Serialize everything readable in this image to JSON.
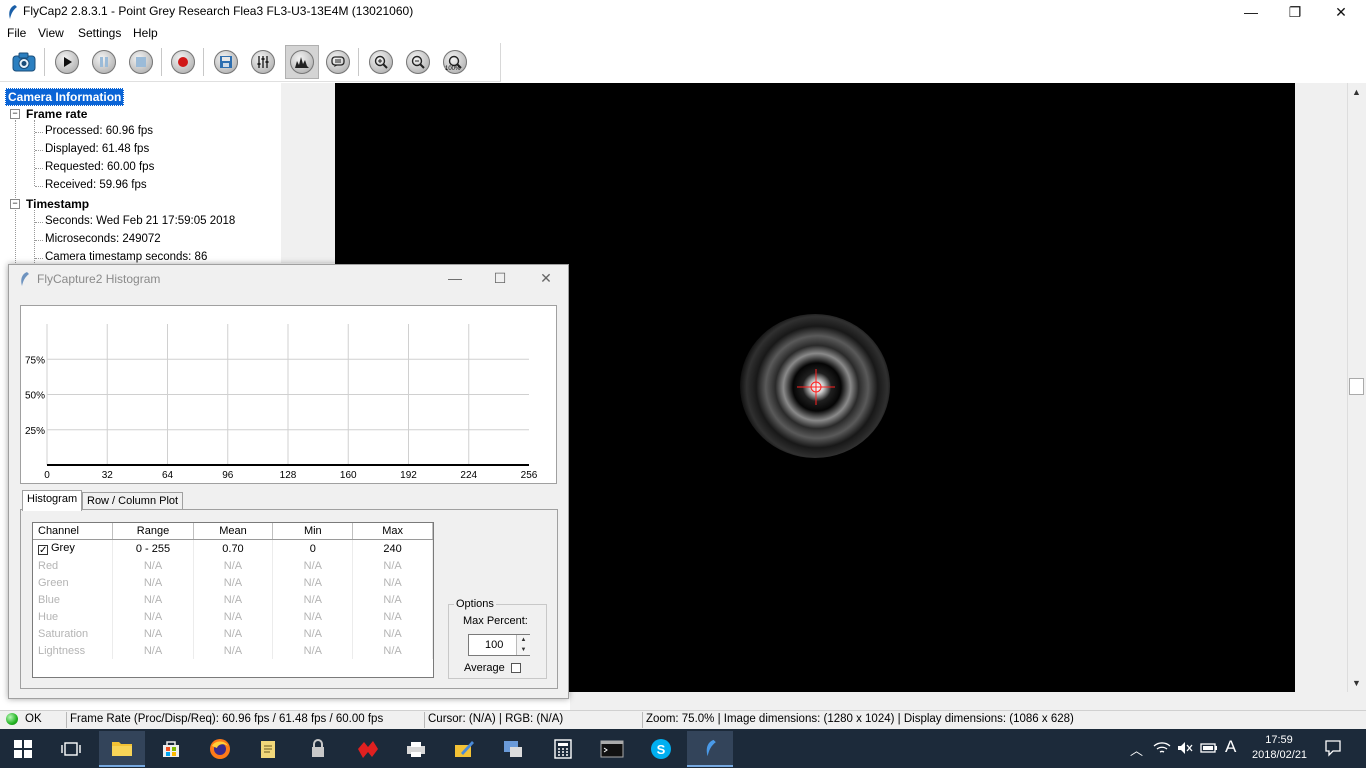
{
  "window": {
    "title": "FlyCap2 2.8.3.1 - Point Grey Research Flea3 FL3-U3-13E4M (13021060)",
    "minimize_glyph": "—",
    "maximize_glyph": "❐",
    "close_glyph": "✕"
  },
  "menu": [
    "File",
    "View",
    "Settings",
    "Help"
  ],
  "toolbar": {
    "buttons": [
      "camera-icon",
      "play-icon",
      "pause-icon",
      "stop-icon",
      "record-icon",
      "save-icon",
      "settings-sliders-icon",
      "histogram-icon",
      "event-stats-icon",
      "zoom-in-icon",
      "zoom-out-icon",
      "zoom-100-icon"
    ],
    "zoom_100_label": "100%"
  },
  "tree": {
    "root": "Camera Information",
    "frame_rate": {
      "label": "Frame rate",
      "items": [
        "Processed: 60.96 fps",
        "Displayed: 61.48 fps",
        "Requested: 60.00 fps",
        "Received: 59.96 fps"
      ]
    },
    "timestamp": {
      "label": "Timestamp",
      "items": [
        "Seconds: Wed Feb 21 17:59:05 2018",
        "Microseconds: 249072",
        "Camera timestamp seconds: 86"
      ]
    },
    "expanded_glyph": "−"
  },
  "histogram_window": {
    "title": "FlyCapture2 Histogram",
    "minimize_glyph": "—",
    "maximize_glyph": "☐",
    "close_glyph": "✕",
    "tabs": [
      "Histogram",
      "Row / Column Plot"
    ],
    "table": {
      "headers": [
        "Channel",
        "Range",
        "Mean",
        "Min",
        "Max"
      ],
      "rows": [
        {
          "channel": "Grey",
          "range": "0 - 255",
          "mean": "0.70",
          "min": "0",
          "max": "240",
          "checked": true,
          "enabled": true
        },
        {
          "channel": "Red",
          "range": "N/A",
          "mean": "N/A",
          "min": "N/A",
          "max": "N/A",
          "enabled": false
        },
        {
          "channel": "Green",
          "range": "N/A",
          "mean": "N/A",
          "min": "N/A",
          "max": "N/A",
          "enabled": false
        },
        {
          "channel": "Blue",
          "range": "N/A",
          "mean": "N/A",
          "min": "N/A",
          "max": "N/A",
          "enabled": false
        },
        {
          "channel": "Hue",
          "range": "N/A",
          "mean": "N/A",
          "min": "N/A",
          "max": "N/A",
          "enabled": false
        },
        {
          "channel": "Saturation",
          "range": "N/A",
          "mean": "N/A",
          "min": "N/A",
          "max": "N/A",
          "enabled": false
        },
        {
          "channel": "Lightness",
          "range": "N/A",
          "mean": "N/A",
          "min": "N/A",
          "max": "N/A",
          "enabled": false
        }
      ]
    },
    "options": {
      "label": "Options",
      "max_percent_label": "Max Percent:",
      "max_percent_value": "100",
      "average_label": "Average",
      "average_checked": false,
      "check_glyph": "✓"
    }
  },
  "chart_data": {
    "type": "line",
    "title": "",
    "xlabel": "",
    "ylabel": "",
    "x_ticks": [
      "0",
      "32",
      "64",
      "96",
      "128",
      "160",
      "192",
      "224",
      "256"
    ],
    "y_ticks": [
      "25%",
      "50%",
      "75%"
    ],
    "xlim": [
      0,
      256
    ],
    "ylim": [
      0,
      100
    ],
    "grid": true,
    "series": [
      {
        "x": [
          0,
          256
        ],
        "values": [
          0,
          0
        ],
        "color": "#000000"
      }
    ]
  },
  "statusbar": {
    "state": "OK",
    "frame_rate": "Frame Rate (Proc/Disp/Req): 60.96 fps / 61.48 fps / 60.00 fps",
    "cursor": "Cursor: (N/A) | RGB: (N/A)",
    "zoom": "Zoom: 75.0% | Image dimensions: (1280 x 1024) | Display dimensions: (1086 x 628)"
  },
  "taskbar": {
    "apps": [
      "start-icon",
      "task-view-icon",
      "file-explorer-icon",
      "store-icon",
      "firefox-icon",
      "notes-icon",
      "security-icon",
      "game-icon",
      "printer-icon",
      "pen-icon",
      "network-icon",
      "calculator-icon",
      "terminal-icon",
      "skype-icon",
      "flycap-icon"
    ],
    "clock_time": "17:59",
    "clock_date": "2018/02/21",
    "ime": "A"
  },
  "colors": {
    "selection": "#0a64d6",
    "status_ok": "#22b422",
    "crosshair": "#ff2020",
    "taskbar": "#1c2a3a"
  }
}
